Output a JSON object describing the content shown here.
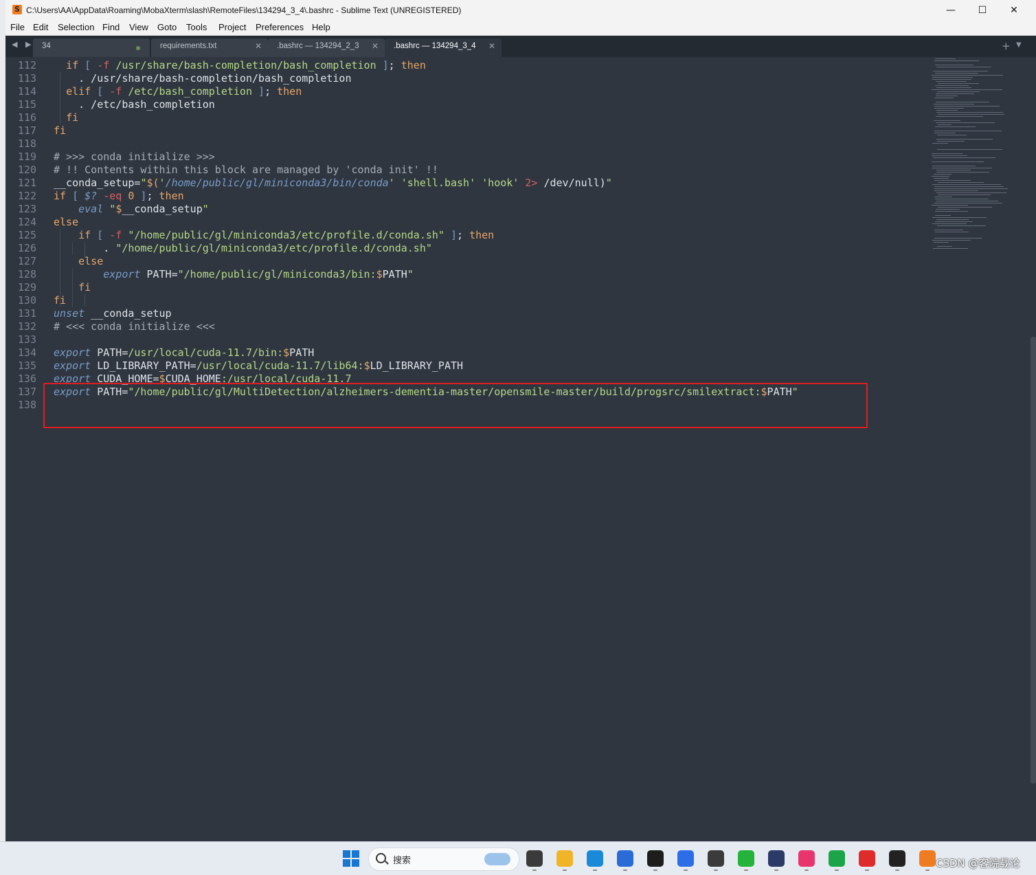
{
  "window": {
    "title": "C:\\Users\\AA\\AppData\\Roaming\\MobaXterm\\slash\\RemoteFiles\\134294_3_4\\.bashrc - Sublime Text (UNREGISTERED)",
    "minimize_glyph": "—",
    "maximize_glyph": "☐",
    "close_glyph": "✕"
  },
  "menu": [
    "File",
    "Edit",
    "Selection",
    "Find",
    "View",
    "Goto",
    "Tools",
    "Project",
    "Preferences",
    "Help"
  ],
  "tabs": [
    {
      "label": "34",
      "state": "modified-dot"
    },
    {
      "label": "requirements.txt",
      "state": "close"
    },
    {
      "label": ".bashrc — 134294_2_3",
      "state": "close"
    },
    {
      "label": ".bashrc — 134294_3_4",
      "state": "close",
      "active": true
    }
  ],
  "tab_nav": "◀ ▶",
  "tab_add": "+",
  "tab_menu": "▼",
  "tab_close_glyph": "✕",
  "editor": {
    "lines": [
      {
        "n": "112",
        "html": "  <span class=\"kw\">if</span> <span class=\"brk\">[</span> <span class=\"op\">-f</span> <span class=\"str\">/usr/share/bash-completion/bash_completion</span> <span class=\"brk\">]</span>; <span class=\"kw\">then</span>"
      },
      {
        "n": "113",
        "html": "    . /usr/share/bash-completion/bash_completion"
      },
      {
        "n": "114",
        "html": "  <span class=\"kw\">elif</span> <span class=\"brk\">[</span> <span class=\"op\">-f</span> <span class=\"str\">/etc/bash_completion</span> <span class=\"brk\">]</span>; <span class=\"kw\">then</span>"
      },
      {
        "n": "115",
        "html": "    . /etc/bash_completion"
      },
      {
        "n": "116",
        "html": "  <span class=\"kw\">fi</span>"
      },
      {
        "n": "117",
        "html": "<span class=\"kw\">fi</span>"
      },
      {
        "n": "118",
        "html": ""
      },
      {
        "n": "119",
        "html": "<span class=\"cmt\"># &gt;&gt;&gt; conda initialize &gt;&gt;&gt;</span>"
      },
      {
        "n": "120",
        "html": "<span class=\"cmt\"># !! Contents within this block are managed by 'conda init' !!</span>"
      },
      {
        "n": "121",
        "html": "__conda_setup=<span class=\"str\">\"</span><span class=\"var\">$(</span><span class=\"str\">'</span><span class=\"kwi\">/home/public/gl/miniconda3/bin/conda</span><span class=\"str\">' 'shell.bash' 'hook'</span> <span class=\"op\">2&gt;</span> /dev/null)<span class=\"str\">\"</span>"
      },
      {
        "n": "122",
        "html": "<span class=\"kw\">if</span> <span class=\"brk\">[</span> <span class=\"kwi\">$?</span> <span class=\"op\">-eq</span> <span class=\"var\">0</span> <span class=\"brk\">]</span>; <span class=\"kw\">then</span>"
      },
      {
        "n": "123",
        "html": "    <span class=\"kwi\">eval</span> <span class=\"str\">\"</span><span class=\"var\">$</span>__conda_setup<span class=\"str\">\"</span>"
      },
      {
        "n": "124",
        "html": "<span class=\"kw\">else</span>"
      },
      {
        "n": "125",
        "html": "    <span class=\"kw\">if</span> <span class=\"brk\">[</span> <span class=\"op\">-f</span> <span class=\"str\">\"/home/public/gl/miniconda3/etc/profile.d/conda.sh\"</span> <span class=\"brk\">]</span>; <span class=\"kw\">then</span>"
      },
      {
        "n": "126",
        "html": "        . <span class=\"str\">\"/home/public/gl/miniconda3/etc/profile.d/conda.sh\"</span>"
      },
      {
        "n": "127",
        "html": "    <span class=\"kw\">else</span>"
      },
      {
        "n": "128",
        "html": "        <span class=\"kwi\">export</span> PATH=<span class=\"str\">\"/home/public/gl/miniconda3/bin:</span><span class=\"var\">$</span>PATH<span class=\"str\">\"</span>"
      },
      {
        "n": "129",
        "html": "    <span class=\"kw\">fi</span>"
      },
      {
        "n": "130",
        "html": "<span class=\"kw\">fi</span>"
      },
      {
        "n": "131",
        "html": "<span class=\"kwi\">unset</span> __conda_setup"
      },
      {
        "n": "132",
        "html": "<span class=\"cmt\"># &lt;&lt;&lt; conda initialize &lt;&lt;&lt;</span>"
      },
      {
        "n": "133",
        "html": ""
      },
      {
        "n": "134",
        "html": "<span class=\"kwi\">export</span> PATH=<span class=\"str\">/usr/local/cuda-11.7/bin:</span><span class=\"var\">$</span>PATH"
      },
      {
        "n": "135",
        "html": "<span class=\"kwi\">export</span> LD_LIBRARY_PATH=<span class=\"str\">/usr/local/cuda-11.7/lib64:</span><span class=\"var\">$</span>LD_LIBRARY_PATH"
      },
      {
        "n": "136",
        "html": "<span class=\"kwi\">export</span> CUDA_HOME=<span class=\"var\">$</span>CUDA_HOME<span class=\"str\">:/usr/local/cuda-11.7</span>"
      },
      {
        "n": "137",
        "html": "<span class=\"kwi\">export</span> PATH=<span class=\"str\">\"/home/public/gl/MultiDetection/alzheimers-dementia-master/opensmile-master/build/progsrc/smilextract:</span><span class=\"var\">$</span>PATH<span class=\"str\">\"</span>"
      },
      {
        "n": "138",
        "html": ""
      }
    ]
  },
  "taskbar": {
    "search_placeholder": "搜索",
    "watermark": "CSDN @客院载论",
    "icons": [
      {
        "name": "files-icon",
        "color": "#3a3a3a"
      },
      {
        "name": "folder-icon",
        "color": "#f0b429"
      },
      {
        "name": "edge-icon",
        "color": "#1a8ad8"
      },
      {
        "name": "store-icon",
        "color": "#2a6bd8"
      },
      {
        "name": "pycharm-icon",
        "color": "#1d1d1d"
      },
      {
        "name": "browser-q-icon",
        "color": "#2d6ee8"
      },
      {
        "name": "mobaxterm-icon",
        "color": "#3b3b3b"
      },
      {
        "name": "wechat-icon",
        "color": "#25b33b"
      },
      {
        "name": "cat-app-icon",
        "color": "#2b3a66"
      },
      {
        "name": "video-app-icon",
        "color": "#e8356e"
      },
      {
        "name": "evernote-icon",
        "color": "#1ca548"
      },
      {
        "name": "netease-music-icon",
        "color": "#e02b2b"
      },
      {
        "name": "qq-icon",
        "color": "#222222"
      },
      {
        "name": "sublime-icon",
        "color": "#f07c21"
      }
    ]
  }
}
